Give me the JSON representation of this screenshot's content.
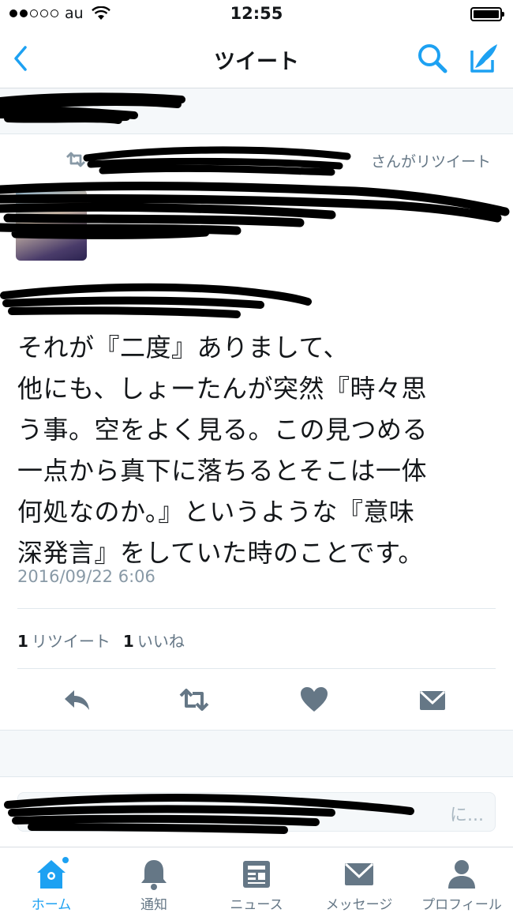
{
  "status_bar": {
    "carrier": "au",
    "time": "12:55"
  },
  "nav": {
    "title": "ツイート"
  },
  "retweet_line": {
    "text": "さんがリツイート"
  },
  "tweet": {
    "lines": [
      "それが『二度』ありまして、",
      "他にも、しょーたんが突然『時々思",
      "う事。空をよく見る。この見つめる",
      "一点から真下に落ちるとそこは一体",
      "何処なのか。』というような『意味",
      "深発言』をしていた時のことです。"
    ],
    "timestamp": "2016/09/22 6:06",
    "retweet_count": "1",
    "retweet_label": "リツイート",
    "like_count": "1",
    "like_label": "いいね"
  },
  "reply": {
    "placeholder": "に..."
  },
  "tabs": [
    {
      "label": "ホーム",
      "icon": "home-icon",
      "active": true
    },
    {
      "label": "通知",
      "icon": "bell-icon"
    },
    {
      "label": "ニュース",
      "icon": "news-icon"
    },
    {
      "label": "メッセージ",
      "icon": "envelope-icon"
    },
    {
      "label": "プロフィール",
      "icon": "person-icon"
    }
  ],
  "colors": {
    "accent": "#1da1f2",
    "icon_gray": "#657786",
    "text_gray": "#8899a6",
    "redaction": "#000000"
  }
}
